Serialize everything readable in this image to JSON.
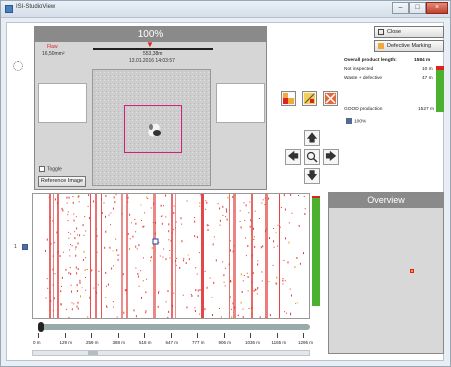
{
  "window": {
    "title": "ISI-StudioView",
    "min": "–",
    "max": "□",
    "close": "×"
  },
  "image_panel": {
    "percent": "100%",
    "flaw_label": "Flaw",
    "flaw_size": "16,50mm²",
    "position": "553,38m",
    "date": "13.01.2016 14:03:57",
    "toggle_label": "Toggle",
    "reference_button": "Reference Image"
  },
  "buttons": {
    "close": "Close",
    "defective_marking": "Defective Marking"
  },
  "stats": {
    "title": "Overall product length:",
    "title_value": "1584 m",
    "not_inspected": "Not inspected",
    "not_inspected_value": "10 m",
    "waste": "Waste + defective",
    "waste_value": "47 m",
    "good": "GOOD production",
    "good_value": "1527 m",
    "pct_check": "100%"
  },
  "navigation": {
    "up": "🡅",
    "left": "🡄",
    "right": "🡆",
    "down": "🡇"
  },
  "lane": {
    "label": "1"
  },
  "overview": {
    "title": "Overview"
  },
  "timeline": {
    "ticks": [
      "0 m",
      "129 m",
      "259 m",
      "388 m",
      "518 m",
      "647 m",
      "777 m",
      "906 m",
      "1036 m",
      "1165 m",
      "1295 m"
    ]
  },
  "colors": {
    "defect": "#e23b3b",
    "good": "#4bb12f",
    "accent": "#d0207c"
  }
}
